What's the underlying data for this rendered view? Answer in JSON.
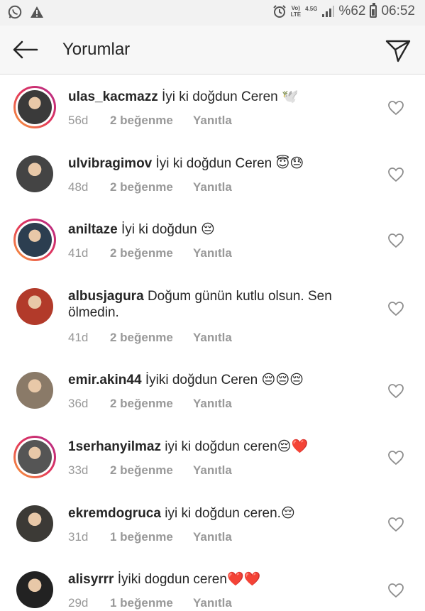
{
  "status_bar": {
    "network_label_top": "Vo)",
    "network_label_bottom": "LTE",
    "network_type": "4.5G",
    "battery": "%62",
    "time": "06:52"
  },
  "header": {
    "title": "Yorumlar"
  },
  "colors": {
    "story_ring_start": "#f9a33b",
    "story_ring_end": "#b02a8c",
    "heart": "#e0245e"
  },
  "comments": [
    {
      "username": "ulas_kacmazz",
      "text": "İyi ki doğdun Ceren 🕊️",
      "age": "56d",
      "likes": "2 beğenme",
      "reply": "Yanıtla",
      "story_ring": true,
      "avatar_color": "#3a3a3a"
    },
    {
      "username": "ulvibragimov",
      "text": "İyi ki doğdun Ceren 😇😓",
      "age": "48d",
      "likes": "2 beğenme",
      "reply": "Yanıtla",
      "story_ring": false,
      "avatar_color": "#444444"
    },
    {
      "username": "aniltaze",
      "text": "İyi ki doğdun 😔",
      "age": "41d",
      "likes": "2 beğenme",
      "reply": "Yanıtla",
      "story_ring": true,
      "avatar_color": "#2c3e50"
    },
    {
      "username": "albusjagura",
      "text": "Doğum günün kutlu olsun. Sen ölmedin.",
      "age": "41d",
      "likes": "2 beğenme",
      "reply": "Yanıtla",
      "story_ring": false,
      "avatar_color": "#b23a2a"
    },
    {
      "username": "emir.akin44",
      "text": "İyiki doğdun Ceren 😔😔😔",
      "age": "36d",
      "likes": "2 beğenme",
      "reply": "Yanıtla",
      "story_ring": false,
      "avatar_color": "#8a7a68"
    },
    {
      "username": "1serhanyilmaz",
      "text": "iyi ki doğdun ceren😔❤️",
      "age": "33d",
      "likes": "2 beğenme",
      "reply": "Yanıtla",
      "story_ring": true,
      "avatar_color": "#555555"
    },
    {
      "username": "ekremdogruca",
      "text": "iyi ki doğdun ceren.😔",
      "age": "31d",
      "likes": "1 beğenme",
      "reply": "Yanıtla",
      "story_ring": false,
      "avatar_color": "#3c3a36"
    },
    {
      "username": "alisyrrr",
      "text": "İyiki dogdun ceren❤️❤️",
      "age": "29d",
      "likes": "1 beğenme",
      "reply": "Yanıtla",
      "story_ring": false,
      "avatar_color": "#222222"
    }
  ]
}
